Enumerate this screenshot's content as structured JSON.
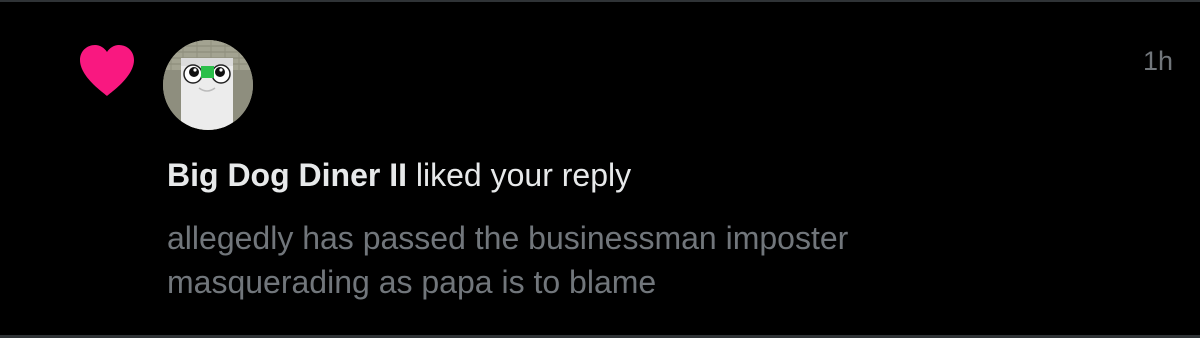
{
  "notification": {
    "type_icon": "heart-icon",
    "avatar_icon": "avatar",
    "timestamp": "1h",
    "user_name": "Big Dog Diner II",
    "action_text": "liked your reply",
    "reply_line_1": "allegedly has passed the businessman imposter",
    "reply_line_2": "masquerading as papa is to blame"
  },
  "colors": {
    "background": "#000000",
    "heart": "#f91880",
    "primary_text": "#e7e9ea",
    "secondary_text": "#71767b",
    "divider": "#2f3336"
  }
}
